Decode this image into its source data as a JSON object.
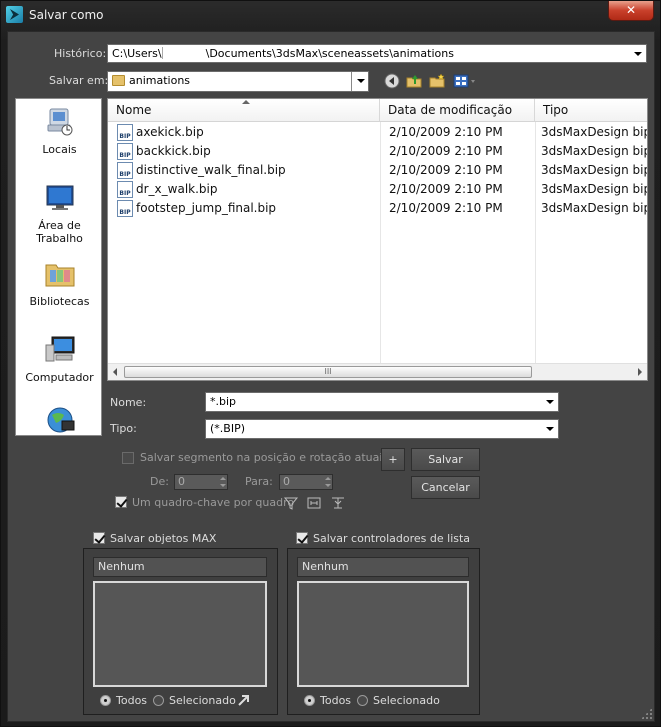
{
  "window": {
    "title": "Salvar como",
    "close_glyph": "✕"
  },
  "history": {
    "label": "Histórico:",
    "path_prefix": "C:\\Users\\",
    "path_suffix": "\\Documents\\3dsMax\\sceneassets\\animations"
  },
  "save_in": {
    "label": "Salvar em:",
    "value": "animations"
  },
  "places": [
    {
      "label_line1": "Locais",
      "label_line2": ""
    },
    {
      "label_line1": "Área de",
      "label_line2": "Trabalho"
    },
    {
      "label_line1": "Bibliotecas",
      "label_line2": ""
    },
    {
      "label_line1": "Computador",
      "label_line2": ""
    }
  ],
  "file_list": {
    "columns": [
      "Nome",
      "Data de modificação",
      "Tipo"
    ],
    "icon_text": "BIP",
    "files": [
      {
        "name": "axekick.bip",
        "date": "2/10/2009 2:10 PM",
        "type": "3dsMaxDesign bip..."
      },
      {
        "name": "backkick.bip",
        "date": "2/10/2009 2:10 PM",
        "type": "3dsMaxDesign bip..."
      },
      {
        "name": "distinctive_walk_final.bip",
        "date": "2/10/2009 2:10 PM",
        "type": "3dsMaxDesign bip..."
      },
      {
        "name": "dr_x_walk.bip",
        "date": "2/10/2009 2:10 PM",
        "type": "3dsMaxDesign bip..."
      },
      {
        "name": "footstep_jump_final.bip",
        "date": "2/10/2009 2:10 PM",
        "type": "3dsMaxDesign bip..."
      }
    ],
    "scroll_grip": "III"
  },
  "name_field": {
    "label": "Nome:",
    "value": "*.bip"
  },
  "type_field": {
    "label": "Tipo:",
    "value": "(*.BIP)"
  },
  "options": {
    "save_segment_label": "Salvar segmento na posição e rotação atuais",
    "from_label": "De:",
    "from_value": "0",
    "to_label": "Para:",
    "to_value": "0",
    "keyframe_label": "Um quadro-chave por quadro",
    "plus_label": "+",
    "save_button": "Salvar",
    "cancel_button": "Cancelar"
  },
  "max_objects": {
    "checkbox_label": "Salvar objetos MAX",
    "list_header": "Nenhum",
    "radio_all": "Todos",
    "radio_selected": "Selecionado"
  },
  "list_controllers": {
    "checkbox_label": "Salvar controladores de lista",
    "list_header": "Nenhum",
    "radio_all": "Todos",
    "radio_selected": "Selecionado"
  },
  "colors": {
    "accent_title": "#c9402b",
    "panel": "#444444",
    "list_bg": "#ffffff"
  }
}
